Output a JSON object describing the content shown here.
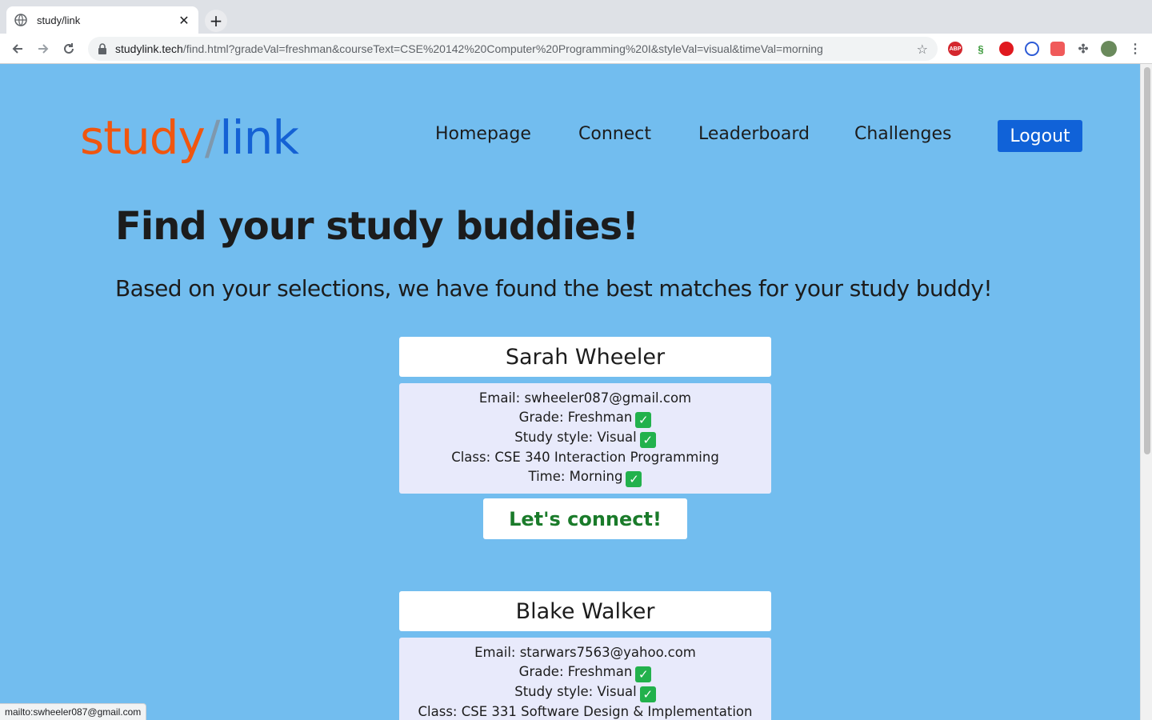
{
  "browser": {
    "tab_title": "study/link",
    "tab_close": "✕",
    "new_tab": "+",
    "url_host": "studylink.tech",
    "url_path": "/find.html?gradeVal=freshman&courseText=CSE%20142%20Computer%20Programming%20I&styleVal=visual&timeVal=morning",
    "extensions": [
      "abp-icon",
      "link-icon",
      "stop-icon",
      "block-icon",
      "shield-icon",
      "puzzle-icon",
      "avatar"
    ],
    "status_url": "mailto:swheeler087@gmail.com"
  },
  "header": {
    "logo_study": "study",
    "logo_slash": "/",
    "logo_link": "link",
    "nav": [
      "Homepage",
      "Connect",
      "Leaderboard",
      "Challenges"
    ],
    "logout": "Logout"
  },
  "main": {
    "title": "Find your study buddies!",
    "subtitle": "Based on your selections, we have found the best matches for your study buddy!",
    "matches": [
      {
        "name": "Sarah Wheeler",
        "email": "Email: swheeler087@gmail.com",
        "grade": "Grade: Freshman",
        "style": "Study style: Visual",
        "class": "Class: CSE 340 Interaction Programming",
        "time": "Time: Morning",
        "connect": "Let's connect!"
      },
      {
        "name": "Blake Walker",
        "email": "Email: starwars7563@yahoo.com",
        "grade": "Grade: Freshman",
        "style": "Study style: Visual",
        "class": "Class: CSE 331 Software Design & Implementation"
      }
    ]
  },
  "colors": {
    "page_bg": "#72bdef",
    "logo_orange": "#f0560f",
    "logo_blue": "#1461d4",
    "logout_bg": "#1062d8",
    "connect_text": "#1a7b2a",
    "check_green": "#22b14c"
  }
}
